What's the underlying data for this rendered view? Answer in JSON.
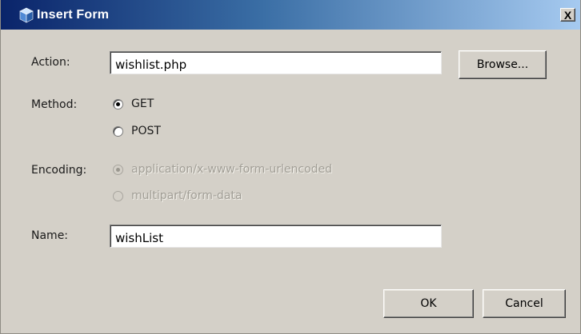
{
  "window": {
    "title": "Insert Form",
    "close_label": "X"
  },
  "action": {
    "label": "Action:",
    "value": "wishlist.php",
    "browse_label": "Browse..."
  },
  "method": {
    "label": "Method:",
    "options": [
      {
        "label": "GET",
        "checked": true
      },
      {
        "label": "POST",
        "checked": false
      }
    ]
  },
  "encoding": {
    "label": "Encoding:",
    "options": [
      {
        "label": "application/x-www-form-urlencoded",
        "checked": true,
        "disabled": true
      },
      {
        "label": "multipart/form-data",
        "checked": false,
        "disabled": true
      }
    ]
  },
  "name": {
    "label": "Name:",
    "value": "wishList"
  },
  "buttons": {
    "ok_label": "OK",
    "cancel_label": "Cancel"
  }
}
